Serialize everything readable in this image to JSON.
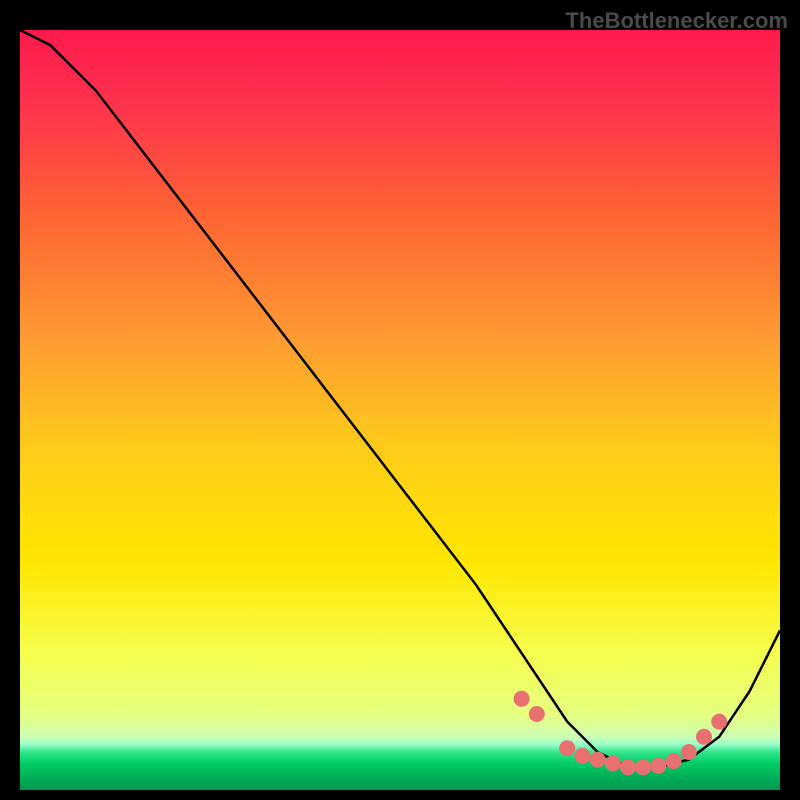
{
  "watermark": "TheBottlenecker.com",
  "chart_data": {
    "type": "line",
    "title": "",
    "xlabel": "",
    "ylabel": "",
    "xlim": [
      0,
      100
    ],
    "ylim": [
      0,
      100
    ],
    "background_gradient": {
      "top": "#ff1a4d",
      "upper_mid": "#ff8033",
      "mid": "#ffe600",
      "lower_mid": "#e6ff66",
      "bottom_band": "#00d96b",
      "bottom_band_start": 92
    },
    "series": [
      {
        "name": "curve",
        "type": "line",
        "color": "#000000",
        "x": [
          0,
          4,
          10,
          20,
          30,
          40,
          50,
          60,
          68,
          72,
          76,
          80,
          84,
          88,
          92,
          96,
          100
        ],
        "y": [
          100,
          98,
          92,
          79,
          66,
          53,
          40,
          27,
          15,
          9,
          5,
          3,
          3,
          4,
          7,
          13,
          21
        ]
      },
      {
        "name": "markers",
        "type": "scatter",
        "color": "#e87070",
        "x": [
          66,
          68,
          72,
          74,
          76,
          78,
          80,
          82,
          84,
          86,
          88,
          90,
          92
        ],
        "y": [
          12,
          10,
          5.5,
          4.5,
          4,
          3.5,
          3,
          3,
          3.2,
          3.8,
          5,
          7,
          9
        ]
      }
    ]
  }
}
